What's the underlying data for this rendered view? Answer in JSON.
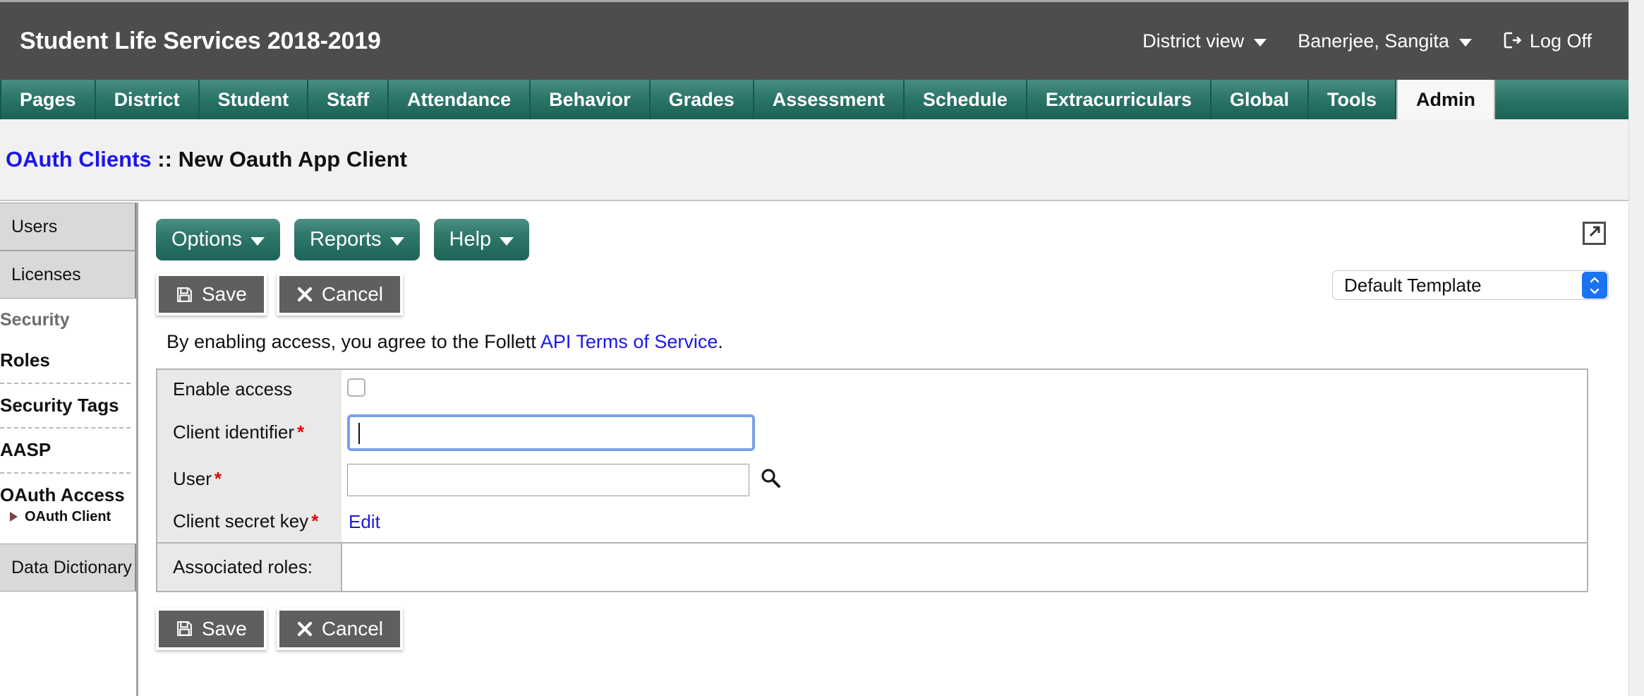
{
  "header": {
    "app_title": "Student Life Services 2018-2019",
    "district_view": "District view",
    "user_name": "Banerjee, Sangita",
    "log_off": "Log Off"
  },
  "nav": {
    "tabs": [
      {
        "label": "Pages",
        "active": false
      },
      {
        "label": "District",
        "active": false
      },
      {
        "label": "Student",
        "active": false
      },
      {
        "label": "Staff",
        "active": false
      },
      {
        "label": "Attendance",
        "active": false
      },
      {
        "label": "Behavior",
        "active": false
      },
      {
        "label": "Grades",
        "active": false
      },
      {
        "label": "Assessment",
        "active": false
      },
      {
        "label": "Schedule",
        "active": false
      },
      {
        "label": "Extracurriculars",
        "active": false
      },
      {
        "label": "Global",
        "active": false
      },
      {
        "label": "Tools",
        "active": false
      },
      {
        "label": "Admin",
        "active": true
      }
    ]
  },
  "breadcrumb": {
    "parent": "OAuth Clients",
    "separator": "::",
    "current": "New Oauth App Client"
  },
  "sidebar": {
    "top_buttons": [
      {
        "label": "Users"
      },
      {
        "label": "Licenses"
      }
    ],
    "group_label": "Security",
    "links": [
      {
        "label": "Roles"
      },
      {
        "label": "Security Tags"
      },
      {
        "label": "AASP"
      },
      {
        "label": "OAuth Access"
      }
    ],
    "sub_item": "OAuth Client",
    "bottom_button": "Data Dictionary"
  },
  "toolbar": {
    "options": "Options",
    "reports": "Reports",
    "help": "Help",
    "popout_icon": "popout-icon"
  },
  "actions": {
    "save": "Save",
    "cancel": "Cancel",
    "save_icon": "floppy-disk-icon",
    "cancel_icon": "close-x-icon"
  },
  "template": {
    "selected": "Default Template"
  },
  "terms": {
    "text_before": "By enabling access, you agree to the Follett ",
    "link": "API Terms of Service",
    "text_after": "."
  },
  "form": {
    "rows": [
      {
        "label": "Enable access",
        "required": false,
        "type": "checkbox",
        "value": ""
      },
      {
        "label": "Client identifier",
        "required": true,
        "type": "text-focused",
        "value": ""
      },
      {
        "label": "User",
        "required": true,
        "type": "text-with-search",
        "value": ""
      },
      {
        "label": "Client secret key",
        "required": true,
        "type": "link",
        "value": "Edit"
      }
    ],
    "associated_roles_label": "Associated roles:",
    "associated_roles_value": ""
  },
  "colors": {
    "header_bg": "#4d4d4d",
    "nav_teal": "#2c766a",
    "link_blue": "#1c16e8",
    "required_red": "#e60000",
    "button_gray": "#5f5f5f",
    "sidebar_item": "#d9d9d9"
  }
}
